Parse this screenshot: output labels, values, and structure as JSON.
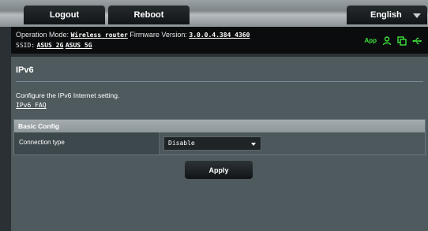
{
  "topbar": {
    "logout_label": "Logout",
    "reboot_label": "Reboot",
    "language_label": "English"
  },
  "info": {
    "operation_mode_label": "Operation Mode:",
    "operation_mode_value": "Wireless router",
    "firmware_label": "Firmware Version:",
    "firmware_value": "3.0.0.4.384_4360",
    "ssid_label": "SSID:",
    "ssid_2g": "ASUS_2G",
    "ssid_5g": "ASUS_5G",
    "app_label": "App"
  },
  "icons": [
    "user-icon",
    "copy-icon",
    "usb-icon"
  ],
  "colors": {
    "status_green": "#3fe23c"
  },
  "page": {
    "title": "IPv6",
    "description": "Configure the IPv6 Internet setting.",
    "faq_link": "IPv6_FAQ"
  },
  "config": {
    "header": "Basic Config",
    "rows": [
      {
        "label": "Connection type",
        "value": "Disable"
      }
    ]
  },
  "apply_label": "Apply"
}
